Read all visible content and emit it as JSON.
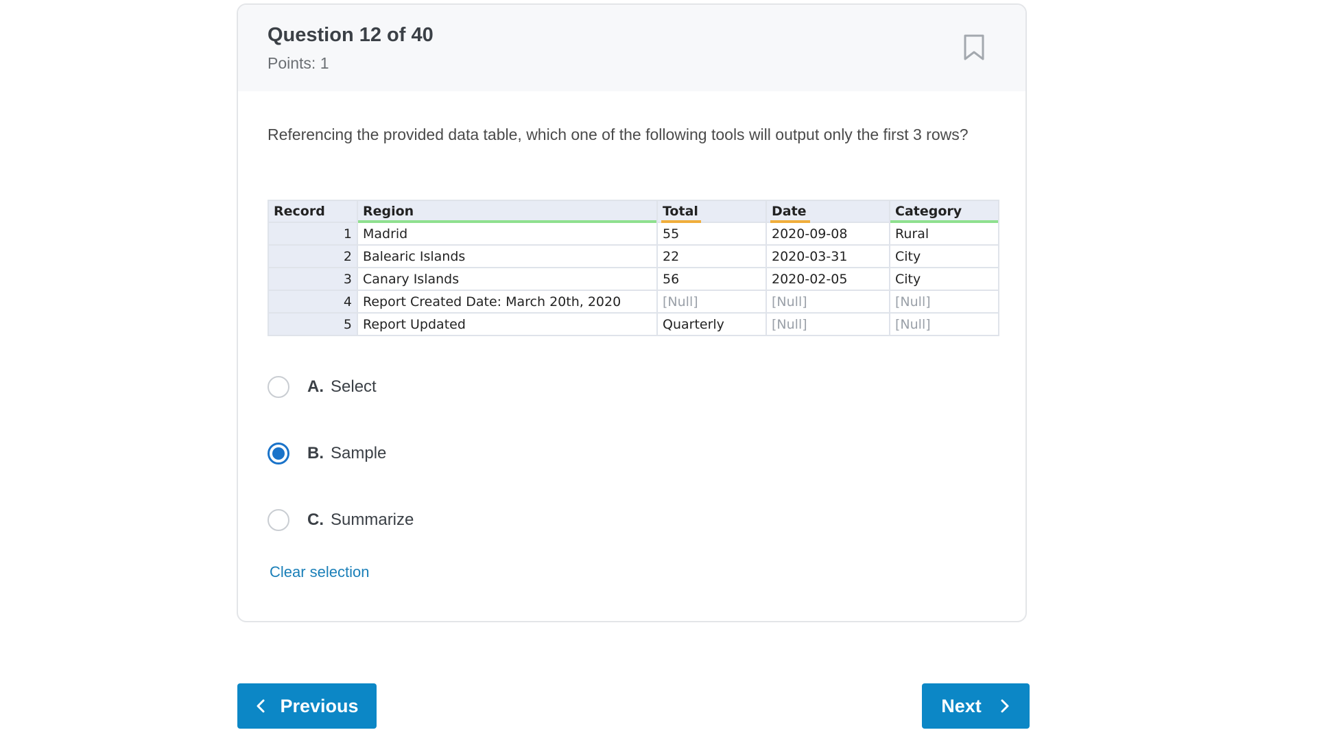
{
  "question": {
    "title": "Question 12 of 40",
    "points": "Points: 1",
    "text": "Referencing the provided data table, which one of the following tools will output only the first 3 rows?"
  },
  "table": {
    "headers": [
      "Record",
      "Region",
      "Total",
      "Date",
      "Category"
    ],
    "rows": [
      [
        "1",
        "Madrid",
        "55",
        "2020-09-08",
        "Rural"
      ],
      [
        "2",
        "Balearic Islands",
        "22",
        "2020-03-31",
        "City"
      ],
      [
        "3",
        "Canary Islands",
        "56",
        "2020-02-05",
        "City"
      ],
      [
        "4",
        "Report Created Date: March 20th, 2020",
        "[Null]",
        "[Null]",
        "[Null]"
      ],
      [
        "5",
        "Report Updated",
        "Quarterly",
        "[Null]",
        "[Null]"
      ]
    ]
  },
  "options": [
    {
      "letter": "A.",
      "label": "Select",
      "selected": false
    },
    {
      "letter": "B.",
      "label": "Sample",
      "selected": true
    },
    {
      "letter": "C.",
      "label": "Summarize",
      "selected": false
    }
  ],
  "clear_selection": "Clear selection",
  "nav": {
    "previous": "Previous",
    "next": "Next"
  },
  "colors": {
    "accent": "#0c87c6",
    "radio_selected": "#1a73c9",
    "link": "#1a7fb8"
  },
  "icons": {
    "bookmark": "bookmark-icon",
    "previous": "chevron-left-icon",
    "next": "chevron-right-icon"
  }
}
